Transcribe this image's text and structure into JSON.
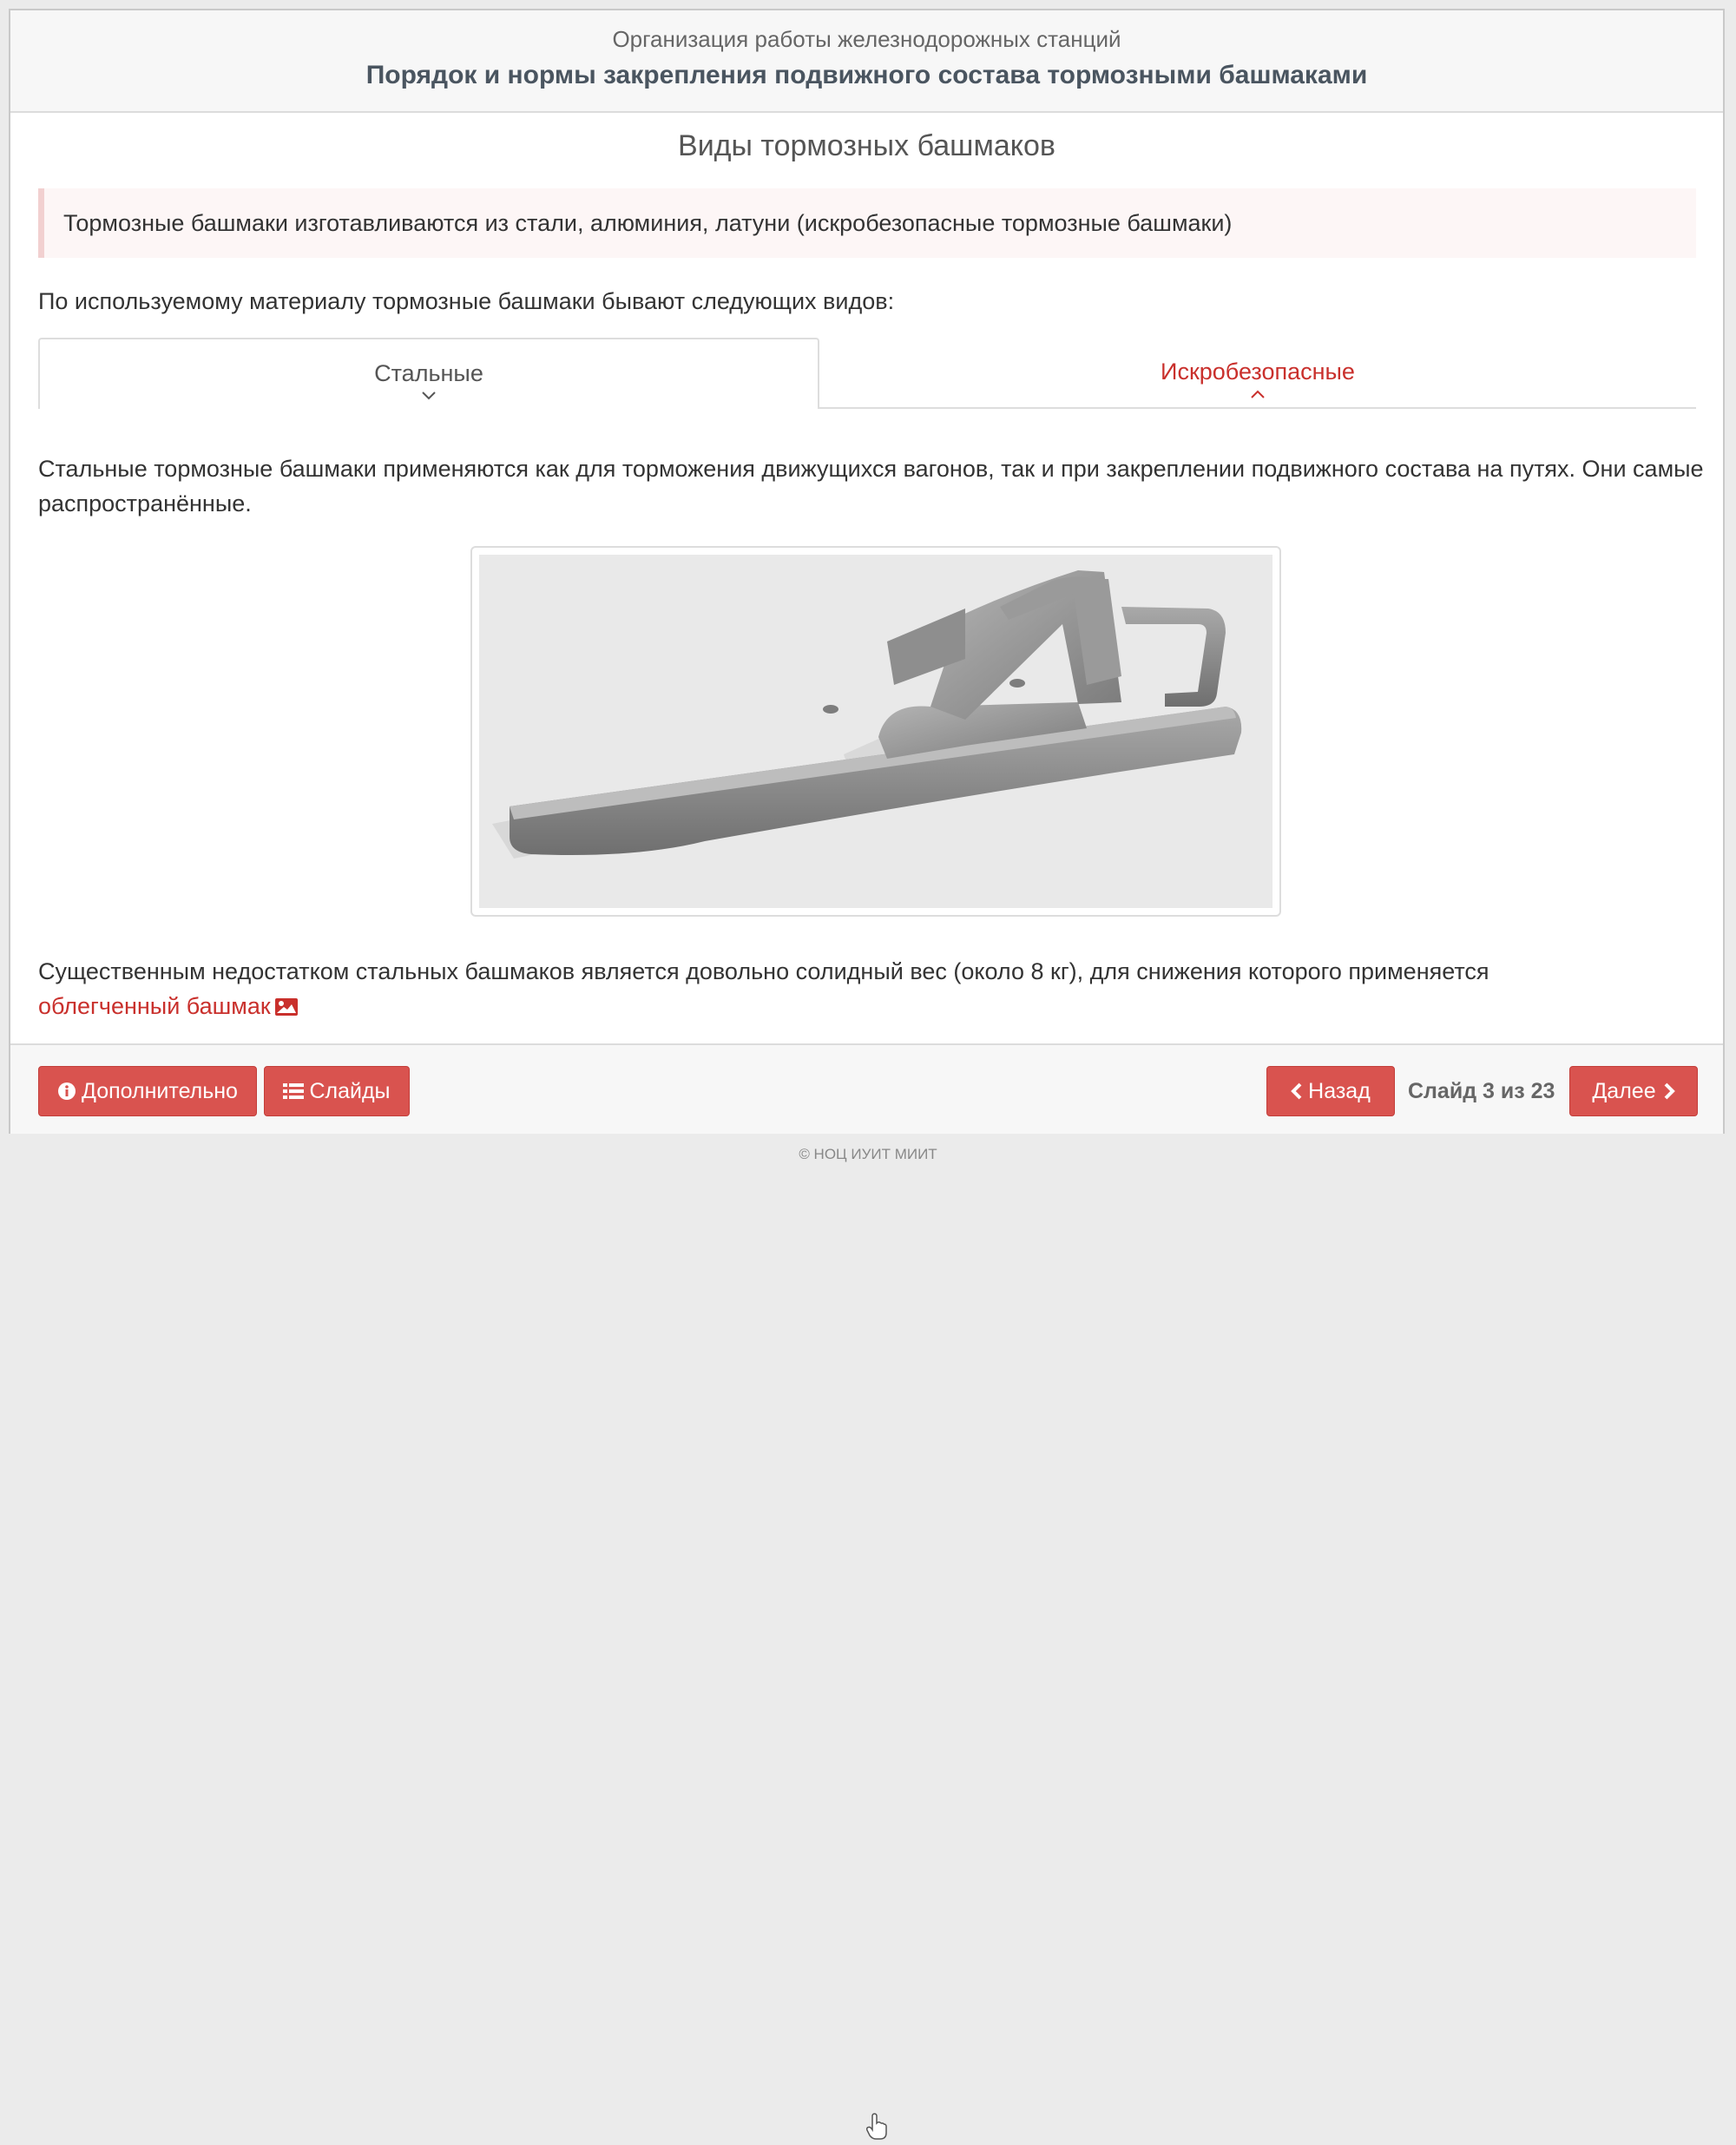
{
  "header": {
    "course": "Организация работы железнодорожных станций",
    "lesson": "Порядок и нормы закрепления подвижного состава тормозными башмаками"
  },
  "slide": {
    "title": "Виды тормозных башмаков",
    "note": "Тормозные башмаки изготавливаются из стали, алюминия, латуни (искробезопасные тормозные башмаки)",
    "intro": "По используемому материалу тормозные башмаки бывают следующих видов:",
    "tabs": [
      {
        "label": "Стальные",
        "chevron": "⌄",
        "active": true
      },
      {
        "label": "Искробезопасные",
        "chevron": "⌃",
        "active": false
      }
    ],
    "body": "Стальные тормозные башмаки применяются как для торможения движущихся вагонов, так и при закреплении подвижного состава на путях. Они самые распространённые.",
    "bottom_text": "Существенным недостатком стальных башмаков является довольно солидный вес (около 8 кг), для снижения которого применяется",
    "bottom_link": "облегченный башмак",
    "link_icon": "image-icon"
  },
  "footer": {
    "more_label": "Дополнительно",
    "more_icon": "info-circle-icon",
    "slides_label": "Слайды",
    "slides_icon": "list-icon",
    "back_label": "Назад",
    "back_icon": "chevron-left-icon",
    "counter": "Слайд 3 из 23",
    "next_label": "Далее",
    "next_icon": "chevron-right-icon"
  },
  "copyright": "© НОЦ ИУИТ МИИТ",
  "colors": {
    "accent": "#d9534f",
    "tab_inactive_text": "#c9302c",
    "note_bg": "#fdf6f6",
    "header_bg": "#f7f7f7"
  }
}
